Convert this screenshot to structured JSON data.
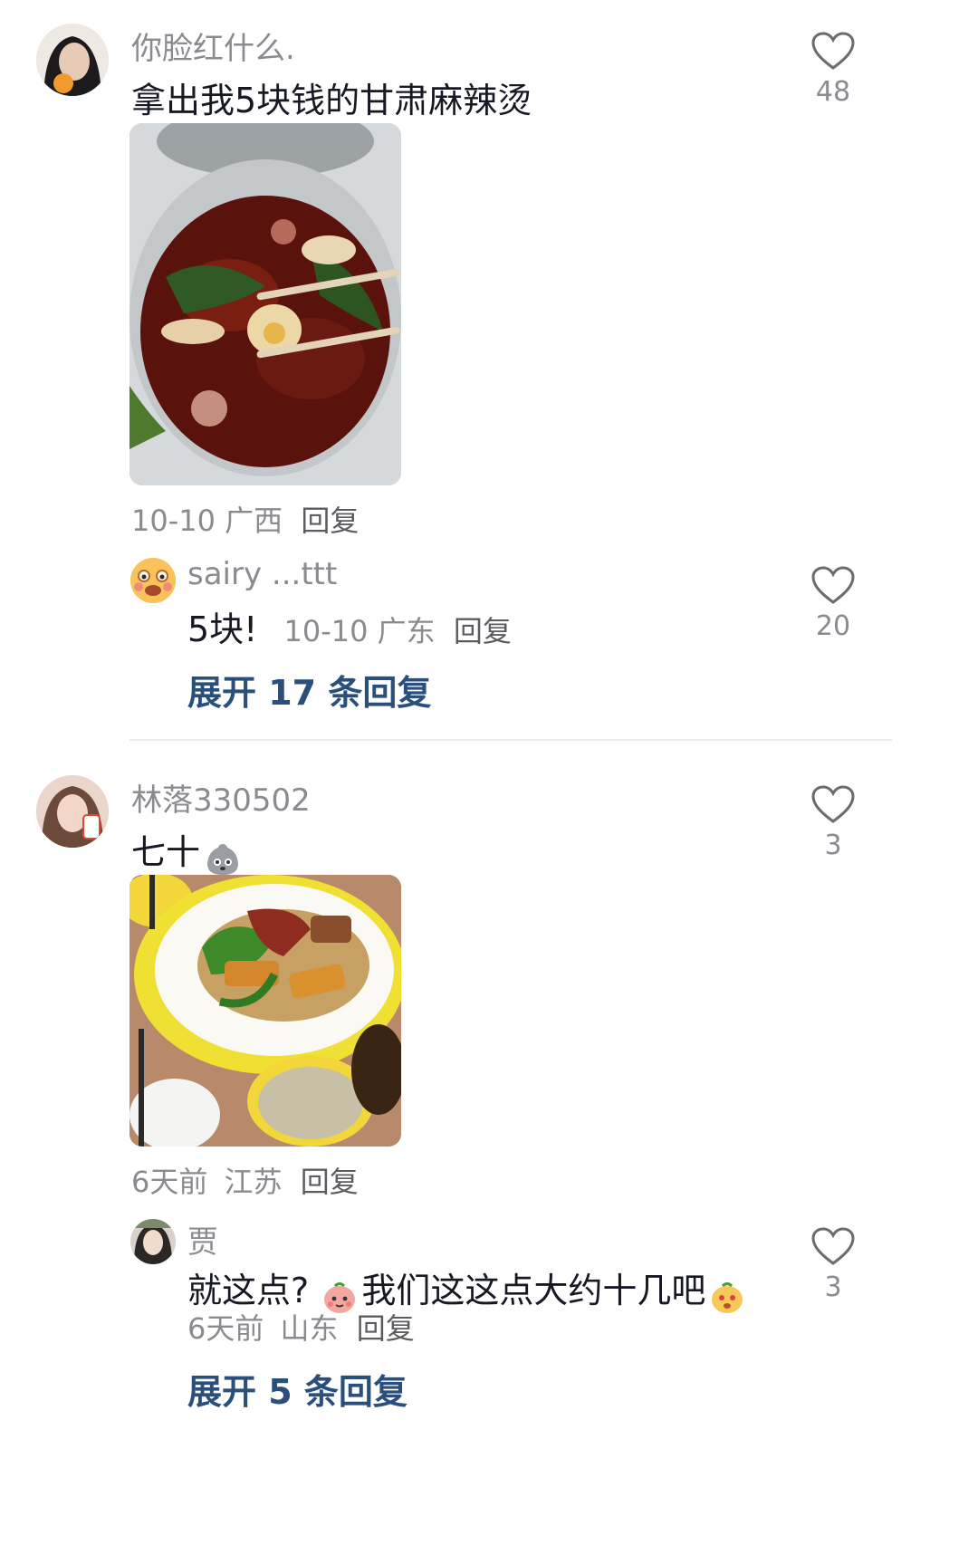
{
  "comments": [
    {
      "username": "你脸红什么.",
      "text": "拿出我5块钱的甘肃麻辣烫",
      "likes": "48",
      "date": "10-10",
      "location": "广西",
      "reply_label": "回复",
      "replies": [
        {
          "username": "sairy ...ttt",
          "text": "5块!",
          "date": "10-10",
          "location": "广东",
          "reply_label": "回复",
          "likes": "20"
        }
      ],
      "expand_label": "展开 17 条回复"
    },
    {
      "username": "林落330502",
      "text": "七十",
      "likes": "3",
      "date": "6天前",
      "location": "江苏",
      "reply_label": "回复",
      "replies": [
        {
          "username": "贾",
          "text_a": "就这点?",
          "text_b": "我们这这点大约十几吧",
          "date": "6天前",
          "location": "山东",
          "reply_label": "回复",
          "likes": "3"
        }
      ],
      "expand_label": "展开 5 条回复"
    }
  ],
  "icons": {
    "like": "heart-outline-icon",
    "sticker_1": "grey-blob-emoji",
    "sticker_2": "pink-face-emoji",
    "sticker_3": "peach-face-emoji"
  }
}
